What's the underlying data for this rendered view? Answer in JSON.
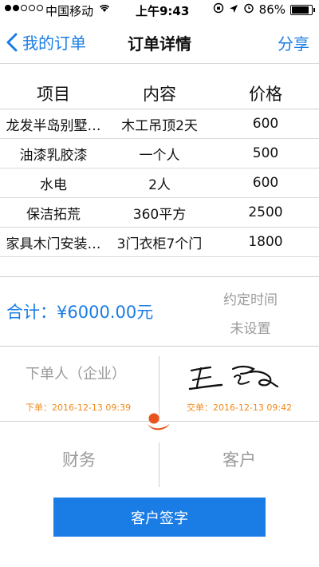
{
  "status_bar": {
    "carrier": "中国移动",
    "time": "上午9:43",
    "battery": "86%",
    "battery_level": 0.86,
    "icons": [
      "signal-dots-icon",
      "wifi-icon",
      "orientation-lock-icon",
      "location-icon",
      "alarm-icon",
      "battery-icon"
    ]
  },
  "nav": {
    "back_label": "我的订单",
    "title": "订单详情",
    "share_label": "分享"
  },
  "table": {
    "headers": [
      "项目",
      "内容",
      "价格"
    ],
    "rows": [
      [
        "龙发半岛别墅…",
        "木工吊顶2天",
        "600"
      ],
      [
        "油漆乳胶漆",
        "一个人",
        "500"
      ],
      [
        "水电",
        "2人",
        "600"
      ],
      [
        "保洁拓荒",
        "360平方",
        "2500"
      ],
      [
        "家具木门安装…",
        "3门衣柜7个门",
        "1800"
      ]
    ]
  },
  "summary": {
    "total": "合计：¥6000.00元",
    "appointment_title": "约定时间",
    "appointment_value": "未设置"
  },
  "signatures": {
    "orderer": "下单人（企业）",
    "order_time": "下单：2016-12-13 09:39",
    "deliver_time": "交单：2016-12-13 09:42"
  },
  "roles": {
    "finance": "财务",
    "customer": "客户"
  },
  "actions": {
    "customer_sign": "客户签字"
  },
  "colors": {
    "accent": "#1a7de6",
    "timestamp": "#f08a1c",
    "muted": "#9a9a9a"
  }
}
